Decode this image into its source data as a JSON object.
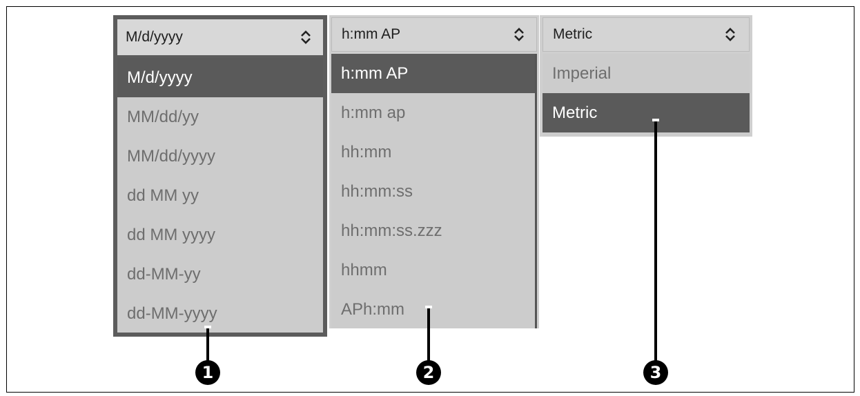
{
  "date_format": {
    "selected": "M/d/yyyy",
    "options": [
      "M/d/yyyy",
      "MM/dd/yy",
      "MM/dd/yyyy",
      "dd MM yy",
      "dd MM yyyy",
      "dd-MM-yy",
      "dd-MM-yyyy"
    ],
    "highlighted_index": 0
  },
  "time_format": {
    "selected": "h:mm AP",
    "options": [
      "h:mm AP",
      "h:mm ap",
      "hh:mm",
      "hh:mm:ss",
      "hh:mm:ss.zzz",
      "hhmm",
      "APh:mm"
    ],
    "highlighted_index": 0
  },
  "units": {
    "selected": "Metric",
    "options": [
      "Imperial",
      "Metric"
    ],
    "highlighted_index": 1
  },
  "callouts": [
    "1",
    "2",
    "3"
  ],
  "icons": {
    "dropdown": "chevron-up-down-icon"
  },
  "colors": {
    "selected_bg": "#5a5a5a",
    "list_bg": "#cccccc",
    "header_bg": "#d4d4d4"
  }
}
